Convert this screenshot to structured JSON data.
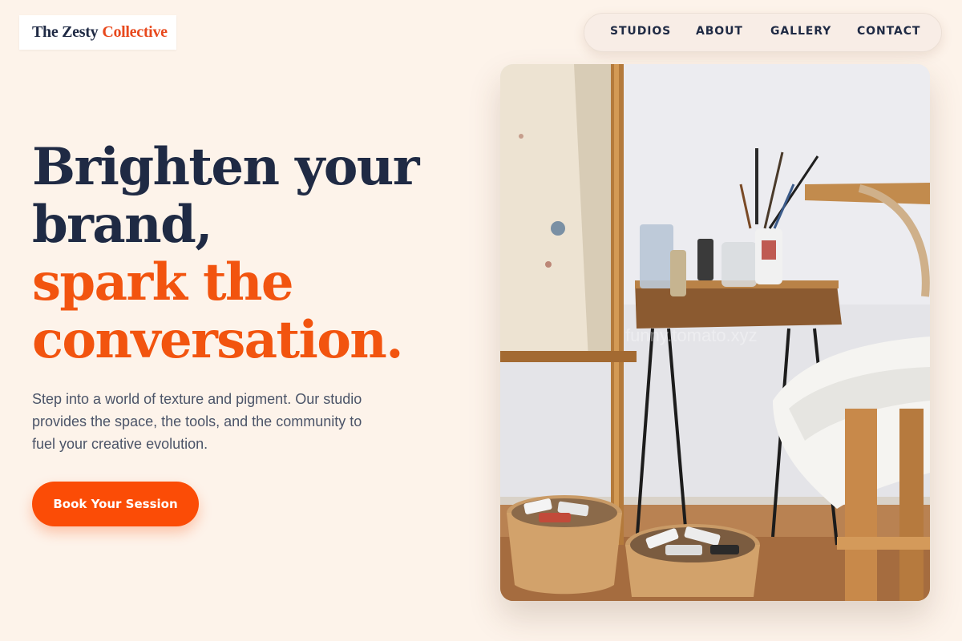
{
  "brand": {
    "name_part1": "The Zesty",
    "name_part2": "Collective"
  },
  "nav": {
    "items": [
      "STUDIOS",
      "ABOUT",
      "GALLERY",
      "CONTACT"
    ]
  },
  "hero": {
    "headline_dark_line1": "Brighten your",
    "headline_dark_line2": "brand,",
    "headline_accent_line1": "spark the",
    "headline_accent_line2": "conversation.",
    "lede_lines": [
      "Step into a world of texture and pigment. Our studio",
      "provides the space, the tools, and the community to",
      "fuel your creative evolution."
    ],
    "cta_label": "Book Your Session"
  },
  "photo": {
    "alt": "Art studio with easel, side table of paint jars and brushes, and bowls of paint tubes",
    "watermark": "funny.tomato.xyz"
  },
  "colors": {
    "background": "#fdf3ea",
    "navy": "#1f2a44",
    "accent": "#f2540f",
    "button": "#fb4c06"
  }
}
